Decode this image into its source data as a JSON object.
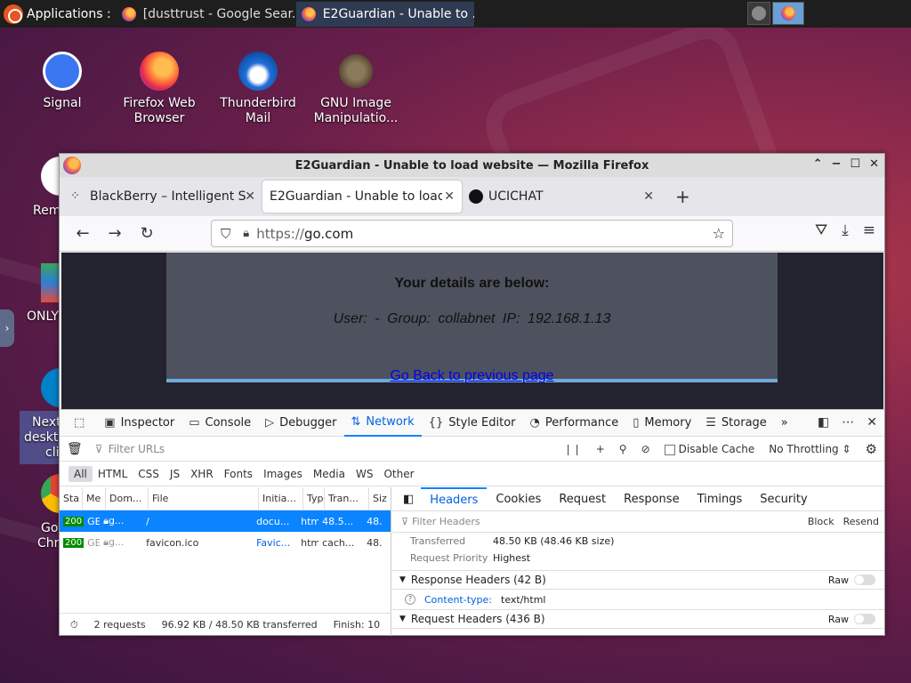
{
  "taskbar": {
    "applications_label": "Applications :",
    "tasks": [
      {
        "label": "[dusttrust - Google Sear..."
      },
      {
        "label": "E2Guardian - Unable to ..."
      }
    ]
  },
  "desktop": {
    "icons": [
      {
        "label": "Signal",
        "icon": "signal-icon"
      },
      {
        "label": "Firefox Web Browser",
        "icon": "firefox-icon"
      },
      {
        "label": "Thunderbird Mail",
        "icon": "thunderbird-icon"
      },
      {
        "label": "GNU Image Manipulatio...",
        "icon": "gimp-icon"
      }
    ],
    "left_clipped": [
      "Rem",
      "ONLYO",
      "Next",
      "deskto",
      "cli",
      "Go",
      "Chr"
    ]
  },
  "window": {
    "title": "E2Guardian - Unable to load website — Mozilla Firefox",
    "tabs": [
      {
        "label": "BlackBerry – Intelligent S"
      },
      {
        "label": "E2Guardian - Unable to load"
      },
      {
        "label": "UCICHAT"
      }
    ],
    "url": {
      "protocol": "https://",
      "host": "go.com"
    }
  },
  "page": {
    "details_title": "Your details are below:",
    "details_info": "User: -   Group: collabnet   IP: 192.168.1.13",
    "go_back": "Go Back to previous page"
  },
  "devtools": {
    "tabs": [
      "Inspector",
      "Console",
      "Debugger",
      "Network",
      "Style Editor",
      "Performance",
      "Memory",
      "Storage"
    ],
    "active_tab": "Network",
    "filter_placeholder": "Filter URLs",
    "disable_cache": "Disable Cache",
    "throttling": "No Throttling ⇕",
    "types": [
      "All",
      "HTML",
      "CSS",
      "JS",
      "XHR",
      "Fonts",
      "Images",
      "Media",
      "WS",
      "Other"
    ],
    "columns": [
      "Sta",
      "Me",
      "Dom...",
      "File",
      "Initia...",
      "Typ",
      "Tran...",
      "Siz"
    ],
    "requests": [
      {
        "status": "200",
        "method": "GET",
        "domain": "g...",
        "file": "/",
        "initiator": "docu...",
        "type": "htm",
        "transferred": "48.5...",
        "size": "48."
      },
      {
        "status": "200",
        "method": "GET",
        "domain": "g...",
        "file": "favicon.ico",
        "initiator": "Favic...",
        "type": "htm",
        "transferred": "cach...",
        "size": "48."
      }
    ],
    "summary": {
      "requests": "2 requests",
      "transferred": "96.92 KB / 48.50 KB transferred",
      "finish": "Finish: 10"
    },
    "details": {
      "tabs": [
        "Headers",
        "Cookies",
        "Request",
        "Response",
        "Timings",
        "Security"
      ],
      "filter_placeholder": "Filter Headers",
      "block": "Block",
      "resend": "Resend",
      "transferred_label": "Transferred",
      "transferred_value": "48.50 KB (48.46 KB size)",
      "priority_label": "Request Priority",
      "priority_value": "Highest",
      "response_headers": "Response Headers (42 B)",
      "raw": "Raw",
      "content_type_key": "Content-type:",
      "content_type_value": "text/html",
      "request_headers": "Request Headers (436 B)"
    }
  }
}
